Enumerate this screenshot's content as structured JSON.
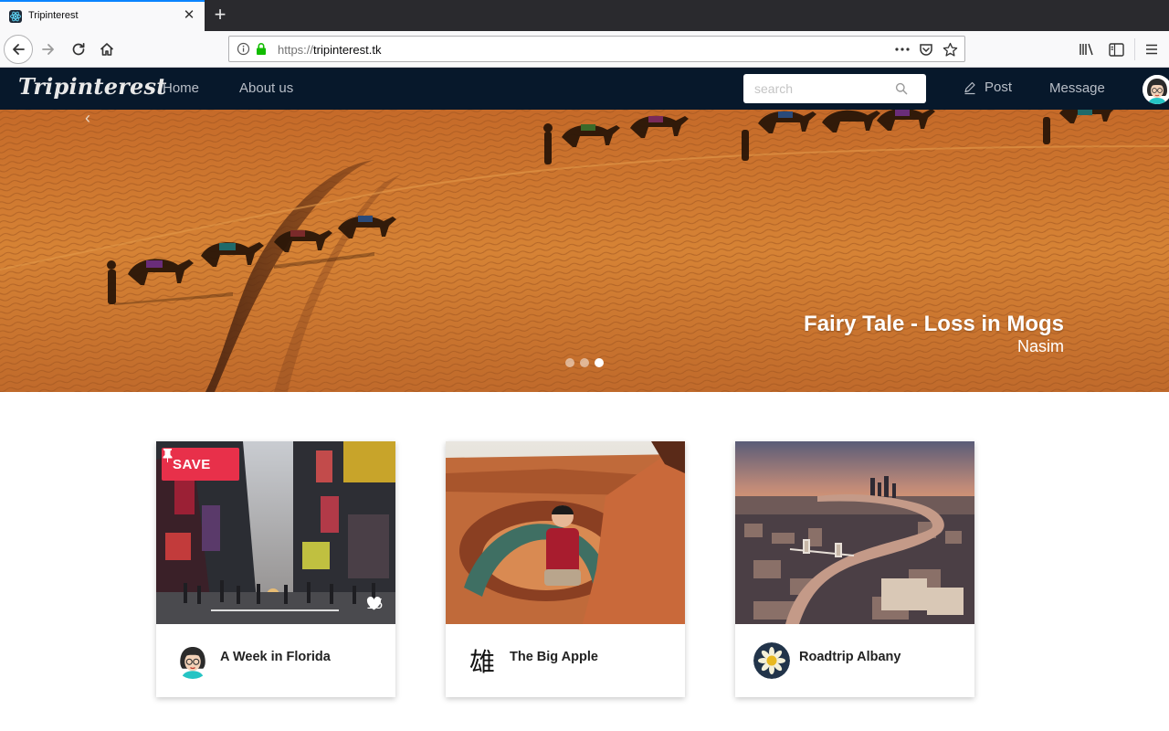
{
  "browser": {
    "tab_title": "Tripinterest",
    "url_scheme": "https://",
    "url_host": "tripinterest.tk"
  },
  "nav": {
    "brand": "Tripinterest",
    "links": [
      "Home",
      "About us"
    ],
    "search_placeholder": "search",
    "post_label": "Post",
    "message_label": "Message"
  },
  "hero": {
    "title": "Fairy Tale - Loss in Mogs",
    "author": "Nasim",
    "slides": 3,
    "active_slide": 3
  },
  "cards": [
    {
      "title": "A Week in Florida",
      "save_label": "SAVE",
      "likes": "15"
    },
    {
      "title": "The Big Apple",
      "avatar_glyph": "雄"
    },
    {
      "title": "Roadtrip Albany"
    }
  ],
  "icons": {
    "tab": "react-atom-icon",
    "back": "arrow-left-icon",
    "forward": "arrow-right-icon",
    "reload": "reload-icon",
    "home": "home-icon",
    "info": "info-icon",
    "lock": "lock-icon",
    "more": "ellipsis-icon",
    "pocket": "pocket-icon",
    "bookmark": "star-icon",
    "library": "library-icon",
    "sidebar": "sidebar-icon",
    "menu": "hamburger-icon",
    "search": "search-icon",
    "post": "pencil-icon",
    "pin": "pushpin-icon",
    "heart": "heart-icon"
  },
  "colors": {
    "nav_bg": "#07182b",
    "save_red": "#e8304a",
    "tab_accent": "#0a84ff"
  }
}
